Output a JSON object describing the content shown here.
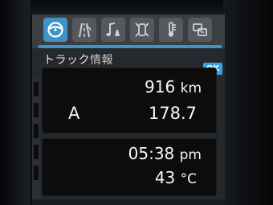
{
  "tabs": [
    {
      "name": "tab-steering",
      "icon": "steering-wheel-icon",
      "active": true
    },
    {
      "name": "tab-lane",
      "icon": "lane-assist-icon",
      "active": false
    },
    {
      "name": "tab-audio",
      "icon": "music-note-icon",
      "active": false
    },
    {
      "name": "tab-vehicle",
      "icon": "vehicle-status-icon",
      "active": false
    },
    {
      "name": "tab-temperature",
      "icon": "thermometer-icon",
      "active": false
    },
    {
      "name": "tab-settings",
      "icon": "settings-icon",
      "active": false
    }
  ],
  "header": {
    "title": "トラック",
    "title_suffix": "情報",
    "ok_label": "OK"
  },
  "trip": {
    "distance_value": "916",
    "distance_unit": "km",
    "trip_label": "A",
    "trip_value": "178.7"
  },
  "status": {
    "time_value": "05:38",
    "time_suffix": "pm",
    "temperature_value": "43",
    "temperature_unit": "°C"
  },
  "colors": {
    "accent": "#3f93c8",
    "ok_button": "#39a3de",
    "panel": "#0c0c0d",
    "text": "#f5f5f5"
  }
}
